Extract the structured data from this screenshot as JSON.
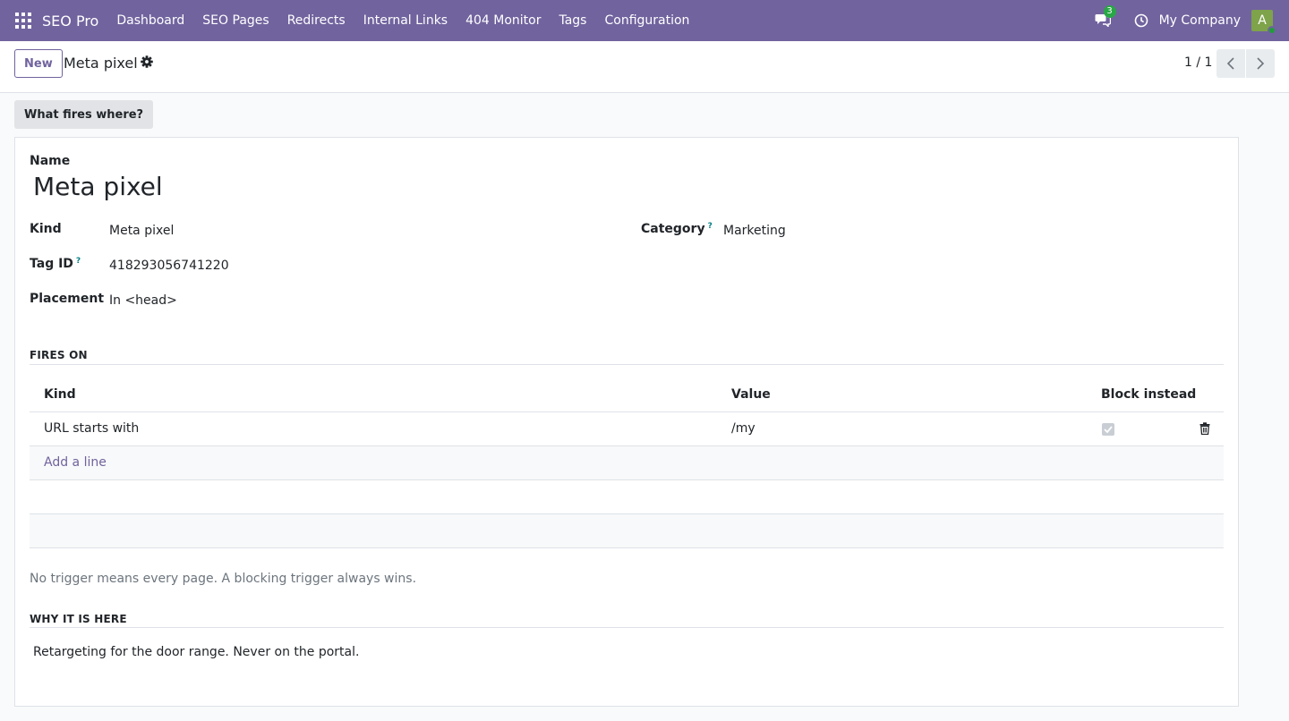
{
  "navbar": {
    "brand": "SEO Pro",
    "menu": [
      "Dashboard",
      "SEO Pages",
      "Redirects",
      "Internal Links",
      "404 Monitor",
      "Tags",
      "Configuration"
    ],
    "chat_count": "3",
    "company": "My Company",
    "avatar_letter": "A",
    "colors": {
      "bar": "#71639e",
      "avatar": "#7ea34a",
      "badge": "#28a745"
    }
  },
  "control": {
    "new_label": "New",
    "record_title": "Meta pixel",
    "pager": "1 / 1"
  },
  "button_box": {
    "what_fires": "What fires where?"
  },
  "form": {
    "name_label": "Name",
    "name_value": "Meta pixel",
    "kind_label": "Kind",
    "kind_value": "Meta pixel",
    "tag_id_label": "Tag ID",
    "tag_id_value": "418293056741220",
    "placement_label": "Placement",
    "placement_value": "In <head>",
    "category_label": "Category",
    "category_value": "Marketing",
    "help_mark": "?"
  },
  "fires_on": {
    "title": "FIRES ON",
    "columns": [
      "Kind",
      "Value",
      "Block instead"
    ],
    "rows": [
      {
        "kind": "URL starts with",
        "value": "/my",
        "block_instead": true
      }
    ],
    "add_line": "Add a line",
    "note": "No trigger means every page. A blocking trigger always wins."
  },
  "why": {
    "title": "WHY IT IS HERE",
    "text": "Retargeting for the door range. Never on the portal."
  }
}
